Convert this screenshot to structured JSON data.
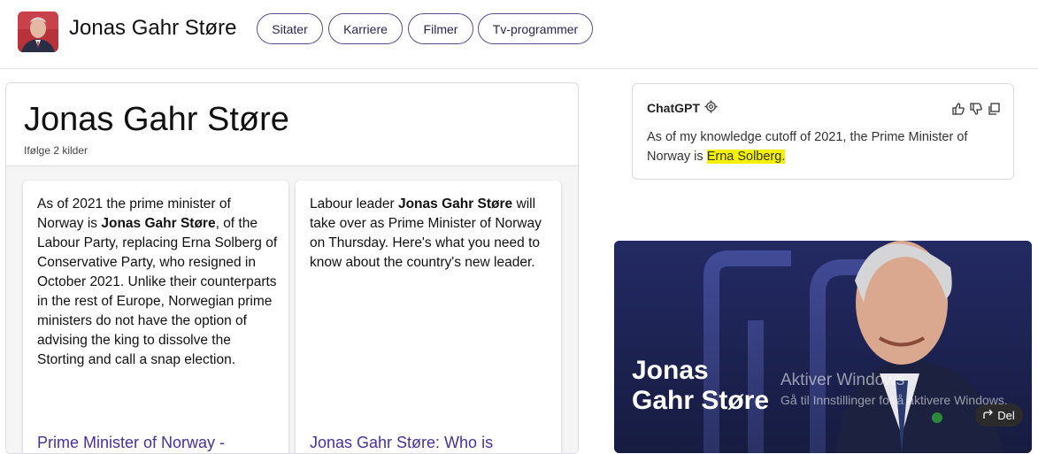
{
  "header": {
    "title": "Jonas Gahr Støre",
    "tabs": [
      "Sitater",
      "Karriere",
      "Filmer",
      "Tv-programmer"
    ]
  },
  "left": {
    "title": "Jonas Gahr Støre",
    "subtitle": "Ifølge 2 kilder",
    "cards": [
      {
        "text_a": "As of 2021 the prime minister of Norway is ",
        "bold": "Jonas Gahr Støre",
        "text_b": ", of the Labour Party, replacing Erna Solberg of Conservative Party, who resigned in October 2021. Unlike their counterparts in the rest of Europe, Norwegian prime ministers do not have the option of advising the king to dissolve the Storting and call a snap election.",
        "link": "Prime Minister of Norway -"
      },
      {
        "text_a": "Labour leader ",
        "bold": "Jonas Gahr Støre",
        "text_b": " will take over as Prime Minister of Norway on Thursday. Here's what you need to know about the country's new leader.",
        "link": "Jonas Gahr Støre: Who is"
      }
    ]
  },
  "chat": {
    "title": "ChatGPT",
    "text_before": "As of my knowledge cutoff of 2021, the Prime Minister of Norway is ",
    "highlight": "Erna Solberg.",
    "highlight_color": "#f4f000"
  },
  "image_card": {
    "name": "Jonas Gahr Støre",
    "share_label": "Del"
  },
  "watermark": {
    "line1": "Aktiver Windows",
    "line2": "Gå til Innstillinger for å aktivere Windows."
  }
}
